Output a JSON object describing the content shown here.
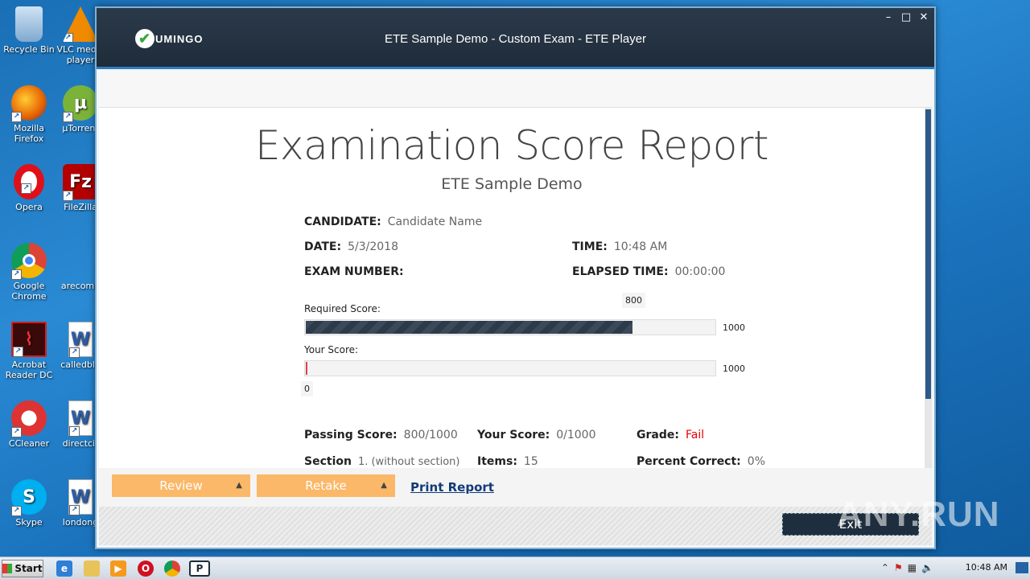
{
  "desktop": {
    "icons": [
      {
        "label": "Recycle Bin",
        "icon": "recycle-bin-icon"
      },
      {
        "label": "VLC media player",
        "icon": "vlc-icon"
      },
      {
        "label": "Mozilla Firefox",
        "icon": "firefox-icon"
      },
      {
        "label": "µTorrent",
        "icon": "utorrent-icon"
      },
      {
        "label": "Opera",
        "icon": "opera-icon"
      },
      {
        "label": "FileZilla",
        "icon": "filezilla-icon"
      },
      {
        "label": "Google Chrome",
        "icon": "chrome-icon"
      },
      {
        "label": "arecomp",
        "icon": "file-icon"
      },
      {
        "label": "Acrobat Reader DC",
        "icon": "acrobat-icon"
      },
      {
        "label": "calledbla",
        "icon": "word-doc-icon"
      },
      {
        "label": "CCleaner",
        "icon": "ccleaner-icon"
      },
      {
        "label": "directcit",
        "icon": "word-doc-icon"
      },
      {
        "label": "Skype",
        "icon": "skype-icon"
      },
      {
        "label": "londong",
        "icon": "word-doc-icon"
      }
    ]
  },
  "window": {
    "logo_text": "UMINGO",
    "title": "ETE Sample Demo - Custom Exam - ETE Player",
    "controls": {
      "minimize": "–",
      "maximize": "□",
      "close": "✕"
    }
  },
  "report": {
    "title": "Examination Score Report",
    "subtitle": "ETE Sample Demo",
    "candidate_label": "CANDIDATE:",
    "candidate_value": "Candidate Name",
    "date_label": "DATE:",
    "date_value": "5/3/2018",
    "time_label": "TIME:",
    "time_value": "10:48 AM",
    "exam_number_label": "EXAM NUMBER:",
    "exam_number_value": "",
    "elapsed_label": "ELAPSED TIME:",
    "elapsed_value": "00:00:00",
    "required_score": {
      "label": "Required Score:",
      "value": "800",
      "max": "1000",
      "fraction": 0.8
    },
    "your_score_bar": {
      "label": "Your Score:",
      "value": "0",
      "max": "1000",
      "fraction": 0.0
    },
    "passing_label": "Passing Score:",
    "passing_value": "800/1000",
    "your_score_label": "Your Score:",
    "your_score_value": "0/1000",
    "grade_label": "Grade:",
    "grade_value": "Fail",
    "section_label": "Section",
    "section_value": "1. (without section)",
    "items_label": "Items:",
    "items_value": "15",
    "percent_label": "Percent Correct:",
    "percent_value": "0%"
  },
  "actions": {
    "review": "Review",
    "retake": "Retake",
    "print": "Print Report",
    "exit": "Exit"
  },
  "watermark": "ANY.RUN",
  "taskbar": {
    "start_label": "Start",
    "clock": "10:48 AM"
  },
  "colors": {
    "accent_orange": "#fbb868",
    "titlebar": "#1f2c3a",
    "fail": "#e00000"
  }
}
